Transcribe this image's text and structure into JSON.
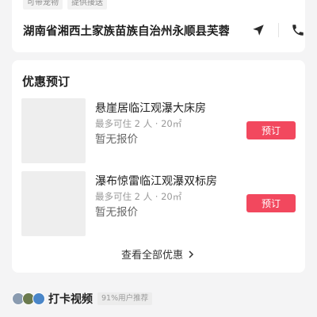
{
  "info": {
    "tags": [
      "可带宠物",
      "提供接送"
    ],
    "address": "湖南省湘西土家族苗族自治州永顺县芙蓉..."
  },
  "offers": {
    "title": "优惠预订",
    "rooms": [
      {
        "name": "悬崖居临江观瀑大床房",
        "capacity": "最多可住 2 人 · 20㎡",
        "price": "暂无报价",
        "book_label": "预订"
      },
      {
        "name": "瀑布惊雷临江观瀑双标房",
        "capacity": "最多可住 2 人 · 20㎡",
        "price": "暂无报价",
        "book_label": "预订"
      }
    ],
    "view_all": "查看全部优惠"
  },
  "videos": {
    "title": "打卡视频",
    "recommend": "91%用户推荐"
  },
  "icons": {
    "navigate": "navigation-arrow-icon",
    "phone": "phone-icon",
    "chevron": "chevron-right-icon"
  },
  "colors": {
    "accent": "#f2485e",
    "background": "#f4f4f5"
  }
}
